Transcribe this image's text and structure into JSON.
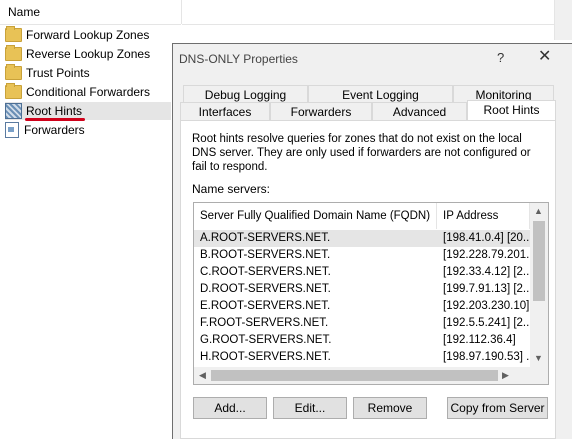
{
  "tree": {
    "column_header": "Name",
    "items": [
      {
        "label": "Forward Lookup Zones",
        "icon": "folder-icon"
      },
      {
        "label": "Reverse Lookup Zones",
        "icon": "folder-icon"
      },
      {
        "label": "Trust Points",
        "icon": "folder-icon"
      },
      {
        "label": "Conditional Forwarders",
        "icon": "folder-icon"
      },
      {
        "label": "Root Hints",
        "icon": "root-hints-icon"
      },
      {
        "label": "Forwarders",
        "icon": "forwarders-icon"
      }
    ]
  },
  "dialog": {
    "title": "DNS-ONLY Properties",
    "help": "?",
    "close": "✕",
    "tabs_row1": [
      "Debug Logging",
      "Event Logging",
      "Monitoring"
    ],
    "tabs_row2": [
      "Interfaces",
      "Forwarders",
      "Advanced",
      "Root Hints"
    ],
    "description": "Root hints resolve queries for zones that do not exist on the local DNS server.   They are only used if forwarders are not configured or fail to respond.",
    "name_servers_label": "Name servers:",
    "columns": [
      "Server Fully Qualified Domain Name (FQDN)",
      "IP Address"
    ],
    "rows": [
      [
        "A.ROOT-SERVERS.NET.",
        "[198.41.0.4] [20..."
      ],
      [
        "B.ROOT-SERVERS.NET.",
        "[192.228.79.201..."
      ],
      [
        "C.ROOT-SERVERS.NET.",
        "[192.33.4.12] [2..."
      ],
      [
        "D.ROOT-SERVERS.NET.",
        "[199.7.91.13] [2..."
      ],
      [
        "E.ROOT-SERVERS.NET.",
        "[192.203.230.10]"
      ],
      [
        "F.ROOT-SERVERS.NET.",
        "[192.5.5.241] [2..."
      ],
      [
        "G.ROOT-SERVERS.NET.",
        "[192.112.36.4]"
      ],
      [
        "H.ROOT-SERVERS.NET.",
        "[198.97.190.53] ..."
      ]
    ],
    "buttons": [
      "Add...",
      "Edit...",
      "Remove",
      "Copy from Server"
    ]
  },
  "colors": {
    "annotation": "#d0021b",
    "selection": "#e5e5e5",
    "dialog_bg": "#f0f0f0"
  }
}
